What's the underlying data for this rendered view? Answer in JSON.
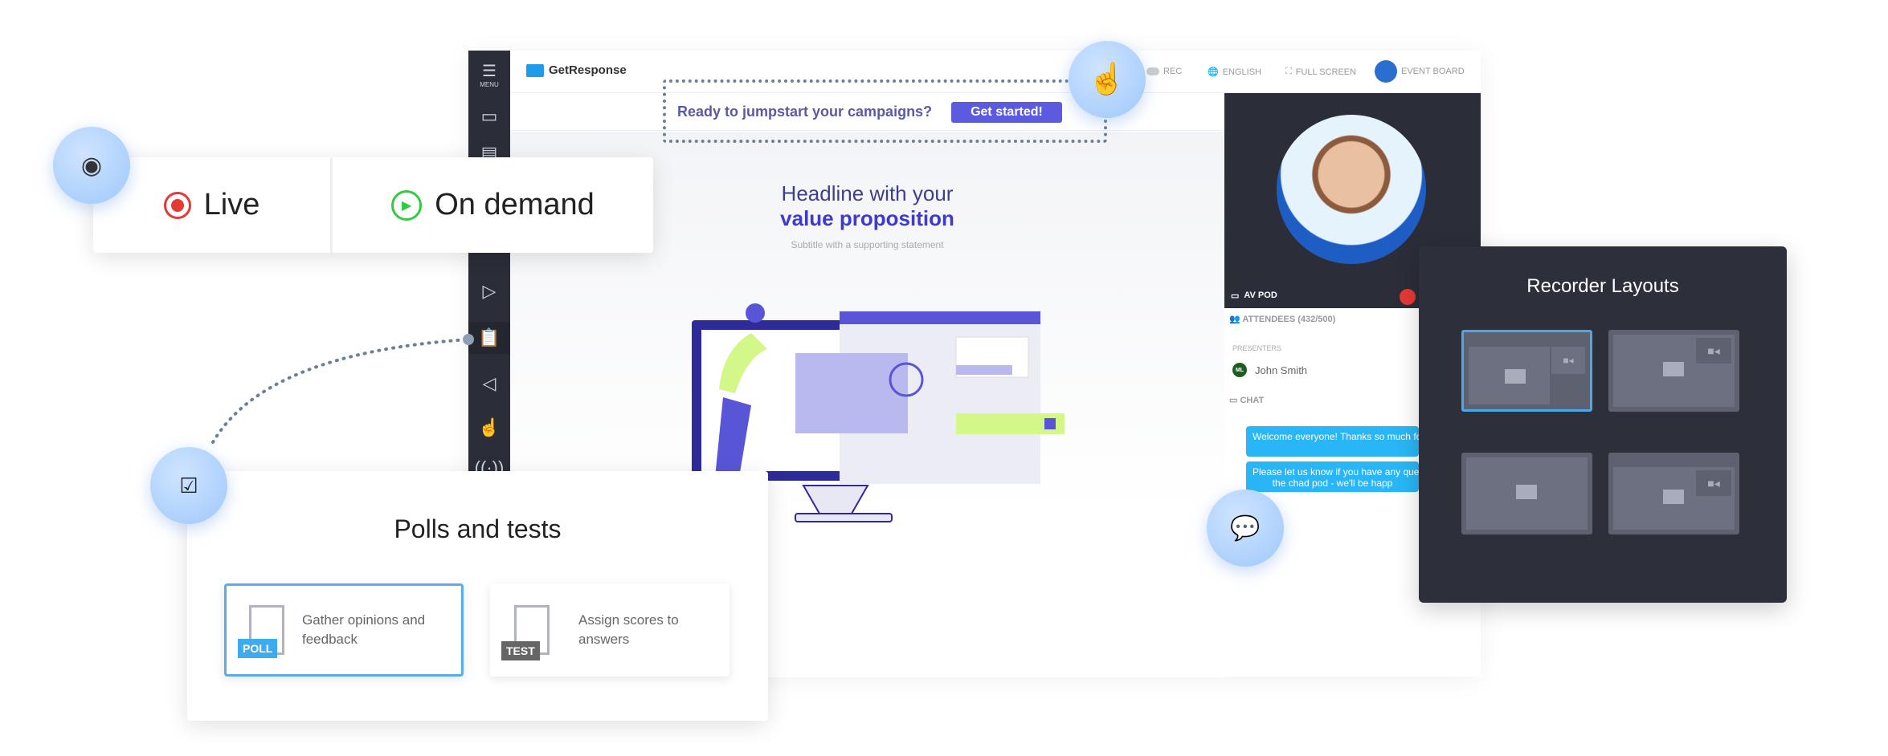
{
  "app": {
    "logo": "GetResponse",
    "menu_label": "MENU"
  },
  "header": {
    "rec": "REC",
    "language": "ENGLISH",
    "fullscreen": "FULL SCREEN",
    "event_board": "EVENT BOARD"
  },
  "banner": {
    "text": "Ready to jumpstart your campaigns?",
    "button": "Get started!"
  },
  "stage": {
    "headline_1": "Headline with your",
    "headline_2": "value proposition",
    "subtitle": "Subtitle with a supporting statement"
  },
  "right_panel": {
    "av_pod": "AV POD",
    "attendees": "ATTENDEES (432/500)",
    "presenters": "PRESENTERS",
    "presenter_initials": "ML",
    "presenter_name": "John Smith",
    "chat": "CHAT",
    "messages": [
      "Welcome everyone! Thanks so much fo",
      "Please let us know if you have any questi\nthe chad pod - we'll be happ"
    ]
  },
  "mode_card": {
    "live": "Live",
    "on_demand": "On demand"
  },
  "polls": {
    "title": "Polls and tests",
    "poll_tag": "POLL",
    "poll_text": "Gather opinions and feedback",
    "test_tag": "TEST",
    "test_text": "Assign scores to answers"
  },
  "recorder": {
    "title": "Recorder Layouts",
    "selected_layout": 1
  },
  "colors": {
    "accent": "#5c5be0",
    "live_red": "#e53935",
    "on_demand_green": "#2ecc40",
    "chat_blue": "#29b6f6",
    "selected_border": "#4aa8e8",
    "dark_panel": "#2d2f3a"
  }
}
